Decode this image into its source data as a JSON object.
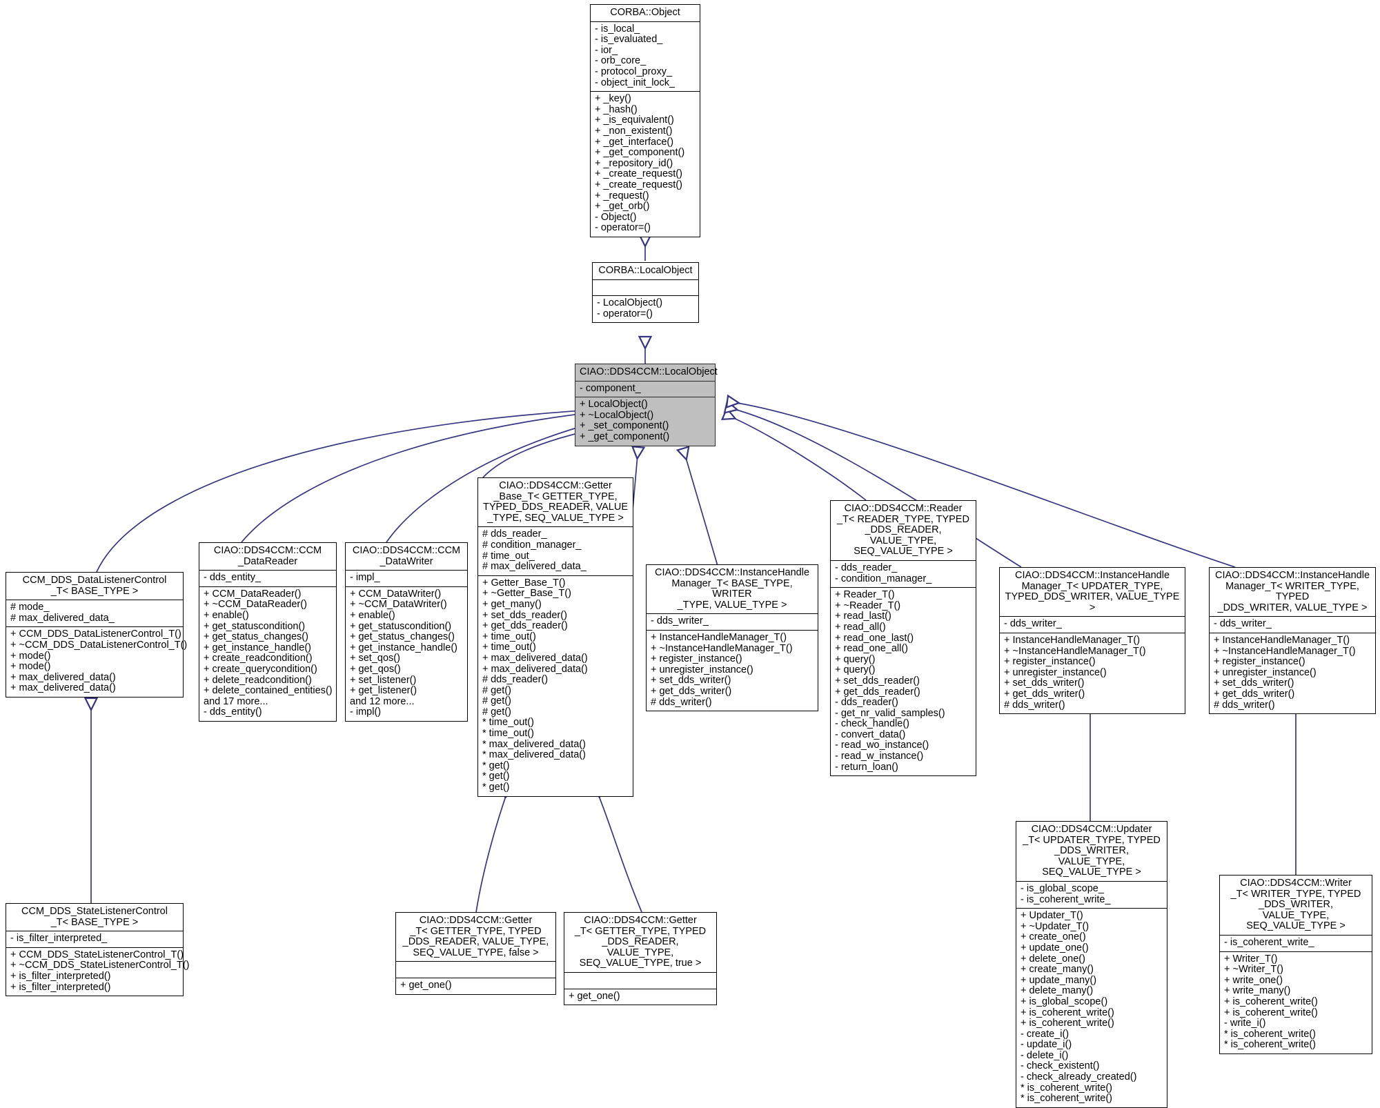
{
  "diagram": {
    "type": "uml-class-inheritance",
    "title": "CIAO::DDS4CCM::LocalObject inheritance diagram",
    "colors": {
      "node_fill": "#ffffff",
      "highlight_fill": "#bfbfbf",
      "border": "#000000",
      "edge": "#353584",
      "text": "#000000"
    }
  },
  "classes": {
    "corba_object": {
      "name": "CORBA::Object",
      "attributes": [
        "- is_local_",
        "- is_evaluated_",
        "- ior_",
        "- orb_core_",
        "- protocol_proxy_",
        "- object_init_lock_"
      ],
      "operations": [
        "+ _key()",
        "+ _hash()",
        "+ _is_equivalent()",
        "+ _non_existent()",
        "+ _get_interface()",
        "+ _get_component()",
        "+ _repository_id()",
        "+ _create_request()",
        "+ _create_request()",
        "+ _request()",
        "+ _get_orb()",
        "- Object()",
        "- operator=()"
      ]
    },
    "corba_localobject": {
      "name": "CORBA::LocalObject",
      "attributes": [],
      "operations": [
        "- LocalObject()",
        "- operator=()"
      ]
    },
    "ciao_localobject": {
      "name": "CIAO::DDS4CCM::LocalObject",
      "highlight": true,
      "attributes": [
        "- component_"
      ],
      "operations": [
        "+ LocalObject()",
        "+ ~LocalObject()",
        "+ _set_component()",
        "+ _get_component()"
      ]
    },
    "data_listener_control": {
      "name": "CCM_DDS_DataListenerControl\n_T< BASE_TYPE >",
      "attributes": [
        "# mode_",
        "# max_delivered_data_"
      ],
      "operations": [
        "+ CCM_DDS_DataListenerControl_T()",
        "+ ~CCM_DDS_DataListenerControl_T()",
        "+ mode()",
        "+ mode()",
        "+ max_delivered_data()",
        "+ max_delivered_data()"
      ]
    },
    "state_listener_control": {
      "name": "CCM_DDS_StateListenerControl\n_T< BASE_TYPE >",
      "attributes": [
        "- is_filter_interpreted_"
      ],
      "operations": [
        "+ CCM_DDS_StateListenerControl_T()",
        "+ ~CCM_DDS_StateListenerControl_T()",
        "+ is_filter_interpreted()",
        "+ is_filter_interpreted()"
      ]
    },
    "ccm_datareader": {
      "name": "CIAO::DDS4CCM::CCM\n_DataReader",
      "attributes": [
        "- dds_entity_"
      ],
      "operations": [
        "+ CCM_DataReader()",
        "+ ~CCM_DataReader()",
        "+ enable()",
        "+ get_statuscondition()",
        "+ get_status_changes()",
        "+ get_instance_handle()",
        "+ create_readcondition()",
        "+ create_querycondition()",
        "+ delete_readcondition()",
        "+ delete_contained_entities()",
        "and 17 more...",
        "- dds_entity()"
      ]
    },
    "ccm_datawriter": {
      "name": "CIAO::DDS4CCM::CCM\n_DataWriter",
      "attributes": [
        "- impl_"
      ],
      "operations": [
        "+ CCM_DataWriter()",
        "+ ~CCM_DataWriter()",
        "+ enable()",
        "+ get_statuscondition()",
        "+ get_status_changes()",
        "+ get_instance_handle()",
        "+ set_qos()",
        "+ get_qos()",
        "+ set_listener()",
        "+ get_listener()",
        "and 12 more...",
        "- impl()"
      ]
    },
    "getter_base_t": {
      "name": "CIAO::DDS4CCM::Getter\n_Base_T< GETTER_TYPE,\nTYPED_DDS_READER, VALUE\n_TYPE, SEQ_VALUE_TYPE >",
      "attributes": [
        "# dds_reader_",
        "# condition_manager_",
        "# time_out_",
        "# max_delivered_data_"
      ],
      "operations": [
        "+ Getter_Base_T()",
        "+ ~Getter_Base_T()",
        "+ get_many()",
        "+ set_dds_reader()",
        "+ get_dds_reader()",
        "+ time_out()",
        "+ time_out()",
        "+ max_delivered_data()",
        "+ max_delivered_data()",
        "# dds_reader()",
        "# get()",
        "# get()",
        "# get()",
        "* time_out()",
        "* time_out()",
        "* max_delivered_data()",
        "* max_delivered_data()",
        "* get()",
        "* get()",
        "* get()"
      ]
    },
    "ihm_base_type": {
      "name": "CIAO::DDS4CCM::InstanceHandle\nManager_T< BASE_TYPE, WRITER\n_TYPE, VALUE_TYPE >",
      "attributes": [
        "- dds_writer_"
      ],
      "operations": [
        "+ InstanceHandleManager_T()",
        "+ ~InstanceHandleManager_T()",
        "+ register_instance()",
        "+ unregister_instance()",
        "+ set_dds_writer()",
        "+ get_dds_writer()",
        "# dds_writer()"
      ]
    },
    "reader_t": {
      "name": "CIAO::DDS4CCM::Reader\n_T< READER_TYPE, TYPED\n_DDS_READER, VALUE_TYPE,\nSEQ_VALUE_TYPE >",
      "attributes": [
        "- dds_reader_",
        "- condition_manager_"
      ],
      "operations": [
        "+ Reader_T()",
        "+ ~Reader_T()",
        "+ read_last()",
        "+ read_all()",
        "+ read_one_last()",
        "+ read_one_all()",
        "+ query()",
        "+ query()",
        "+ set_dds_reader()",
        "+ get_dds_reader()",
        "- dds_reader()",
        "- get_nr_valid_samples()",
        "- check_handle()",
        "- convert_data()",
        "- read_wo_instance()",
        "- read_w_instance()",
        "- return_loan()"
      ]
    },
    "ihm_updater_type": {
      "name": "CIAO::DDS4CCM::InstanceHandle\nManager_T< UPDATER_TYPE,\nTYPED_DDS_WRITER, VALUE_TYPE >",
      "attributes": [
        "- dds_writer_"
      ],
      "operations": [
        "+ InstanceHandleManager_T()",
        "+ ~InstanceHandleManager_T()",
        "+ register_instance()",
        "+ unregister_instance()",
        "+ set_dds_writer()",
        "+ get_dds_writer()",
        "# dds_writer()"
      ]
    },
    "ihm_writer_type": {
      "name": "CIAO::DDS4CCM::InstanceHandle\nManager_T< WRITER_TYPE, TYPED\n_DDS_WRITER, VALUE_TYPE >",
      "attributes": [
        "- dds_writer_"
      ],
      "operations": [
        "+ InstanceHandleManager_T()",
        "+ ~InstanceHandleManager_T()",
        "+ register_instance()",
        "+ unregister_instance()",
        "+ set_dds_writer()",
        "+ get_dds_writer()",
        "# dds_writer()"
      ]
    },
    "getter_t_false": {
      "name": "CIAO::DDS4CCM::Getter\n_T< GETTER_TYPE, TYPED\n_DDS_READER, VALUE_TYPE,\nSEQ_VALUE_TYPE, false >",
      "attributes": [],
      "operations": [
        "+ get_one()"
      ]
    },
    "getter_t_true": {
      "name": "CIAO::DDS4CCM::Getter\n_T< GETTER_TYPE, TYPED\n_DDS_READER, VALUE_TYPE,\nSEQ_VALUE_TYPE, true >",
      "attributes": [],
      "operations": [
        "+ get_one()"
      ]
    },
    "updater_t": {
      "name": "CIAO::DDS4CCM::Updater\n_T< UPDATER_TYPE, TYPED\n_DDS_WRITER, VALUE_TYPE,\nSEQ_VALUE_TYPE >",
      "attributes": [
        "- is_global_scope_",
        "- is_coherent_write_"
      ],
      "operations": [
        "+ Updater_T()",
        "+ ~Updater_T()",
        "+ create_one()",
        "+ update_one()",
        "+ delete_one()",
        "+ create_many()",
        "+ update_many()",
        "+ delete_many()",
        "+ is_global_scope()",
        "+ is_coherent_write()",
        "+ is_coherent_write()",
        "- create_i()",
        "- update_i()",
        "- delete_i()",
        "- check_existent()",
        "- check_already_created()",
        "* is_coherent_write()",
        "* is_coherent_write()"
      ]
    },
    "writer_t": {
      "name": "CIAO::DDS4CCM::Writer\n_T< WRITER_TYPE, TYPED\n_DDS_WRITER, VALUE_TYPE,\nSEQ_VALUE_TYPE >",
      "attributes": [
        "- is_coherent_write_"
      ],
      "operations": [
        "+ Writer_T()",
        "+ ~Writer_T()",
        "+ write_one()",
        "+ write_many()",
        "+ is_coherent_write()",
        "+ is_coherent_write()",
        "- write_i()",
        "* is_coherent_write()",
        "* is_coherent_write()"
      ]
    }
  }
}
